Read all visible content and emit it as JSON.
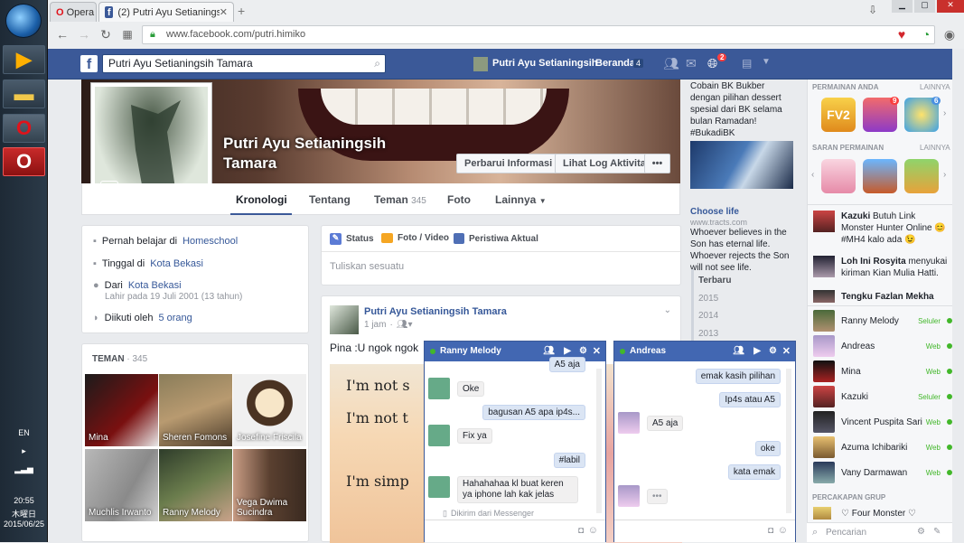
{
  "taskbar": {
    "lang": "EN",
    "time": "20:55",
    "day": "木曜日",
    "date": "2015/06/25"
  },
  "browser": {
    "app_name": "Opera",
    "tab_title": "(2) Putri Ayu Setianingsih dari K",
    "new_tab": "+",
    "url": "www.facebook.com/putri.himiko"
  },
  "fbbar": {
    "search_value": "Putri Ayu Setianingsih Tamara",
    "user_name": "Putri Ayu Setianingsih",
    "home_label": "Beranda",
    "home_count": "4",
    "notif_count": "2"
  },
  "profile": {
    "name": "Putri Ayu Setianingsih Tamara",
    "update_info": "Perbarui Informasi",
    "activity_log": "Lihat Log Aktivitas",
    "more": "•••",
    "tabs": [
      {
        "label": "Kronologi"
      },
      {
        "label": "Tentang"
      },
      {
        "label": "Teman",
        "count": "345"
      },
      {
        "label": "Foto"
      },
      {
        "label": "Lainnya"
      }
    ]
  },
  "intro": {
    "studied_prefix": "Pernah belajar di",
    "studied_place": "Homeschool",
    "lives_prefix": "Tinggal di",
    "lives_place": "Kota Bekasi",
    "from_prefix": "Dari",
    "from_place": "Kota Bekasi",
    "born": "Lahir pada 19 Juli 2001 (13 tahun)",
    "followed_prefix": "Diikuti oleh",
    "followed_count": "5 orang"
  },
  "friends": {
    "title": "TEMAN",
    "count": "345",
    "items": [
      {
        "name": "Mina"
      },
      {
        "name": "Sheren Fomons"
      },
      {
        "name": "Josefine Friscila"
      },
      {
        "name": "Muchlis Irwanto"
      },
      {
        "name": "Ranny Melody"
      },
      {
        "name": "Vega Dwima Sucindra"
      }
    ]
  },
  "composer": {
    "status": "Status",
    "photo": "Foto / Video",
    "event": "Peristiwa Aktual",
    "placeholder": "Tuliskan sesuatu"
  },
  "post": {
    "author": "Putri Ayu Setianingsih Tamara",
    "time": "1 jam",
    "text": "Pina :U ngok ngok",
    "image_lines": [
      "I'm not s",
      "I'm not t",
      "I'm simp"
    ]
  },
  "ads": {
    "ad1_text": "Cobain BK Bukber dengan pilihan dessert spesial dari BK selama bulan Ramadan! #BukadiBK",
    "ad2_title": "Choose life",
    "ad2_url": "www.tracts.com",
    "ad2_text": "Whoever believes in the Son has eternal life. Whoever rejects the Son will not see life."
  },
  "timeline": [
    "Terbaru",
    "2015",
    "2014",
    "2013"
  ],
  "games": {
    "played_title": "PERMAINAN ANDA",
    "suggest_title": "SARAN PERMAINAN",
    "more": "LAINNYA",
    "played_badges": [
      "9",
      "6"
    ],
    "fv2": "FV2"
  },
  "tickers": [
    {
      "name": "Kazuki",
      "text": "Butuh Link Monster Hunter Online 😊 #MH4 kalo ada 😉"
    },
    {
      "name": "Loh Ini Rosyita",
      "text": "menyukai kiriman Kian Mulia Hatti."
    },
    {
      "name": "Tengku Fazlan Mekha",
      "text": ""
    }
  ],
  "chat_list": [
    {
      "name": "Ranny Melody",
      "status": "Seluler"
    },
    {
      "name": "Andreas",
      "status": "Web"
    },
    {
      "name": "Mina",
      "status": "Web"
    },
    {
      "name": "Kazuki",
      "status": "Seluler"
    },
    {
      "name": "Vincent Puspita Sari",
      "status": "Web"
    },
    {
      "name": "Azuma Ichibariki",
      "status": "Web"
    },
    {
      "name": "Vany Darmawan",
      "status": "Web"
    }
  ],
  "group_chats": {
    "title": "PERCAKAPAN GRUP",
    "item": "♡ Four Monster ♡",
    "search_placeholder": "Pencarian"
  },
  "chat1": {
    "name": "Ranny Melody",
    "messages": [
      {
        "from": "me",
        "text": "A5 aja"
      },
      {
        "from": "them",
        "text": "Oke"
      },
      {
        "from": "me",
        "text": "bagusan A5 apa ip4s..."
      },
      {
        "from": "them",
        "text": "Fix ya"
      },
      {
        "from": "me",
        "text": "#labil"
      },
      {
        "from": "them",
        "text": "Hahahahaa kl buat keren ya iphone lah kak jelas"
      }
    ],
    "sent_from": "Dikirim dari Messenger"
  },
  "chat2": {
    "name": "Andreas",
    "messages": [
      {
        "from": "me",
        "text": "emak kasih pilihan"
      },
      {
        "from": "me",
        "text": "Ip4s atau A5"
      },
      {
        "from": "them",
        "text": "A5 aja"
      },
      {
        "from": "me",
        "text": "oke"
      },
      {
        "from": "me",
        "text": "kata emak"
      },
      {
        "from": "them",
        "text": "•••"
      }
    ]
  },
  "colors": {
    "fb_blue": "#3b5998",
    "chat_header": "#4267b2",
    "online": "#42b72a",
    "link": "#365899"
  }
}
